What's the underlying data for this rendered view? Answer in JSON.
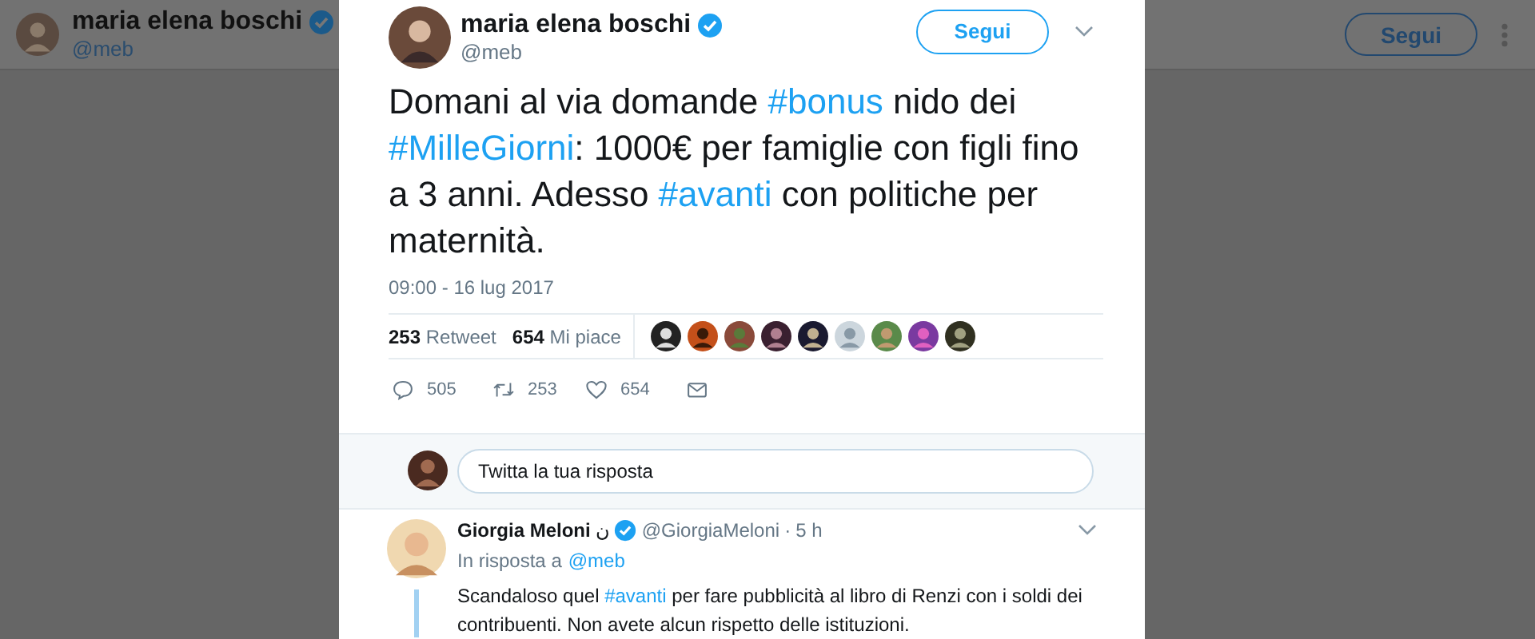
{
  "background": {
    "profile": {
      "name": "maria elena boschi",
      "verified": true,
      "handle": "@meb"
    },
    "follow_button": "Segui"
  },
  "tweet": {
    "author": {
      "name": "maria elena boschi",
      "verified": true,
      "handle": "@meb"
    },
    "follow_button": "Segui",
    "text": [
      {
        "text": "Domani al via domande "
      },
      {
        "text": "#bonus",
        "kind": "hashtag"
      },
      {
        "text": " nido dei "
      },
      {
        "text": "#MilleGiorni",
        "kind": "hashtag"
      },
      {
        "text": ": 1000€ per famiglie con figli fino a 3 anni. Adesso "
      },
      {
        "text": "#avanti",
        "kind": "hashtag"
      },
      {
        "text": " con politiche per maternità."
      }
    ],
    "timestamp": "09:00 - 16 lug 2017",
    "stats": [
      {
        "count": "253",
        "label": "Retweet"
      },
      {
        "count": "654",
        "label": "Mi piace"
      }
    ],
    "actions": [
      {
        "kind": "reply",
        "count": "505"
      },
      {
        "kind": "retweet",
        "count": "253"
      },
      {
        "kind": "like",
        "count": "654"
      },
      {
        "kind": "message"
      }
    ]
  },
  "reply_box": {
    "placeholder": "Twitta la tua risposta"
  },
  "replies": [
    {
      "name": "Giorgia Meloni",
      "name_suffix": "ن",
      "verified": true,
      "handle": "@GiorgiaMeloni",
      "separator": "·",
      "time": "5 h",
      "in_reply_to_label": "In risposta a",
      "in_reply_to": "@meb",
      "text": [
        {
          "text": "Scandaloso quel "
        },
        {
          "text": "#avanti",
          "kind": "hashtag"
        },
        {
          "text": " per fare pubblicità al libro di Renzi con i soldi dei contribuenti. Non avete alcun rispetto delle istituzioni."
        }
      ]
    }
  ]
}
